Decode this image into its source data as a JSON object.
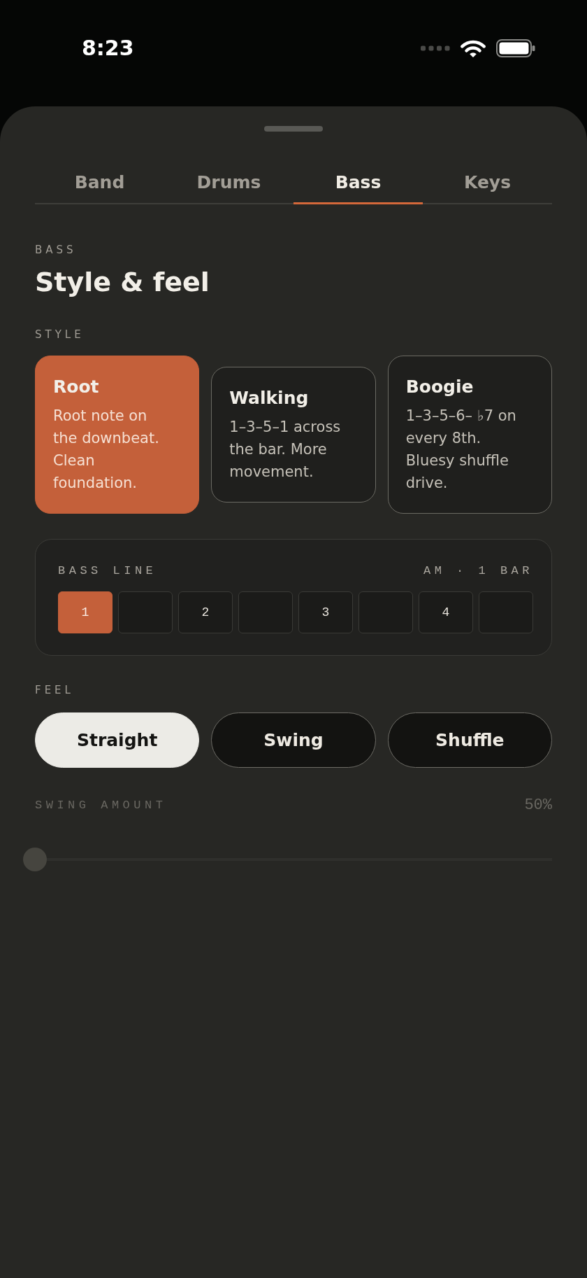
{
  "status_bar": {
    "time": "8:23"
  },
  "tabs": [
    {
      "label": "Band",
      "selected": false
    },
    {
      "label": "Drums",
      "selected": false
    },
    {
      "label": "Bass",
      "selected": true
    },
    {
      "label": "Keys",
      "selected": false
    }
  ],
  "header": {
    "eyebrow": "BASS",
    "title": "Style & feel"
  },
  "style": {
    "label": "STYLE",
    "options": [
      {
        "title": "Root",
        "description": "Root note on the downbeat. Clean foundation.",
        "selected": true
      },
      {
        "title": "Walking",
        "description": "1–3–5–1 across the bar. More movement.",
        "selected": false
      },
      {
        "title": "Boogie",
        "description": "1–3–5–6– ♭7 on every 8th. Bluesy shuffle drive.",
        "selected": false
      }
    ]
  },
  "bass_line": {
    "title": "BASS LINE",
    "meta": "AM · 1 BAR",
    "steps": [
      {
        "label": "1",
        "active": true
      },
      {
        "active": false
      },
      {
        "label": "2",
        "active": false
      },
      {
        "active": false
      },
      {
        "label": "3",
        "active": false
      },
      {
        "active": false
      },
      {
        "label": "4",
        "active": false
      },
      {
        "active": false
      }
    ]
  },
  "feel": {
    "label": "FEEL",
    "options": [
      {
        "label": "Straight",
        "selected": true
      },
      {
        "label": "Swing",
        "selected": false
      },
      {
        "label": "Shuffle",
        "selected": false
      }
    ]
  },
  "swing": {
    "label": "SWING AMOUNT",
    "reading": "50%",
    "level": 0,
    "disabled": true
  }
}
